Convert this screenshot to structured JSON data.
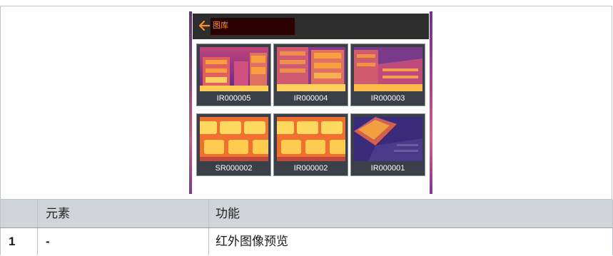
{
  "gallery": {
    "title": "图库",
    "thumbnails": [
      {
        "label": "IR000005"
      },
      {
        "label": "IR000004"
      },
      {
        "label": "IR000003"
      },
      {
        "label": "SR000002"
      },
      {
        "label": "IR000002"
      },
      {
        "label": "IR000001"
      }
    ]
  },
  "table": {
    "headers": [
      "",
      "元素",
      "功能"
    ],
    "rows": [
      {
        "num": "1",
        "element": "-",
        "function": "红外图像预览"
      }
    ]
  },
  "colors": {
    "appbar": "#2d2d2d",
    "accent": "#ff8c2a",
    "table_header": "#d1d4d8"
  }
}
